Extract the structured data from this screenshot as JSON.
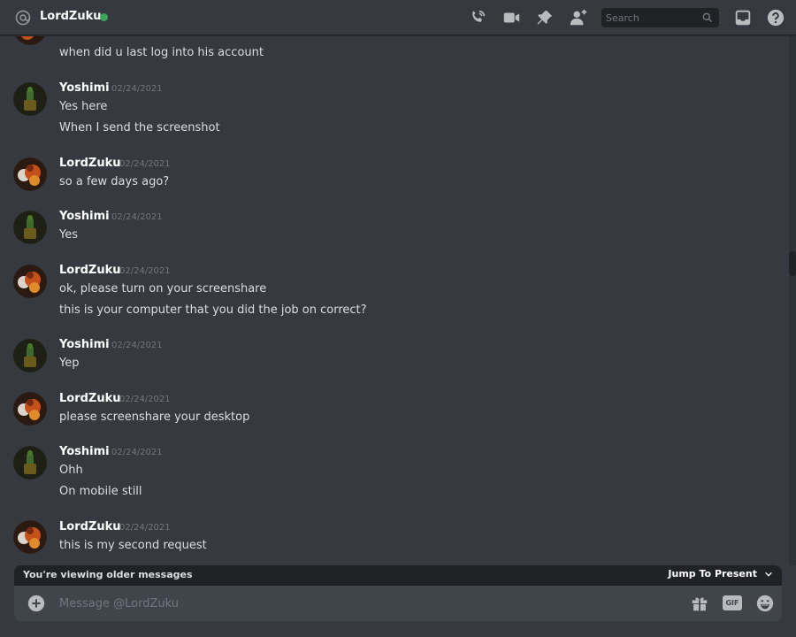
{
  "header": {
    "dm_name": "LordZuku",
    "search_placeholder": "Search",
    "icons": [
      "at-icon",
      "phone-icon",
      "video-icon",
      "pin-icon",
      "add-friend-icon",
      "search-icon",
      "inbox-icon",
      "help-icon"
    ],
    "status_color": "#3ba55d"
  },
  "messages": [
    {
      "lines": [
        "when did u last log into his account"
      ]
    },
    {
      "author": "Yoshimi",
      "timestamp": "02/24/2021",
      "lines": [
        "Yes here",
        "When I send the screenshot"
      ]
    },
    {
      "author": "LordZuku",
      "timestamp": "02/24/2021",
      "lines": [
        "so a few days ago?"
      ]
    },
    {
      "author": "Yoshimi",
      "timestamp": "02/24/2021",
      "lines": [
        "Yes"
      ]
    },
    {
      "author": "LordZuku",
      "timestamp": "02/24/2021",
      "lines": [
        "ok, please turn on your screenshare",
        "this is your computer that you did the job on correct?"
      ]
    },
    {
      "author": "Yoshimi",
      "timestamp": "02/24/2021",
      "lines": [
        "Yep"
      ]
    },
    {
      "author": "LordZuku",
      "timestamp": "02/24/2021",
      "lines": [
        "please screenshare your desktop"
      ]
    },
    {
      "author": "Yoshimi",
      "timestamp": "02/24/2021",
      "lines": [
        "Ohh",
        "On mobile still"
      ]
    },
    {
      "author": "LordZuku",
      "timestamp": "02/24/2021",
      "lines": [
        "this is my second request"
      ]
    }
  ],
  "older_bar": {
    "text": "You're viewing older messages",
    "jump_label": "Jump To Present"
  },
  "composer": {
    "placeholder": "Message @LordZuku",
    "gif_label": "GIF",
    "icons": [
      "plus-circle-icon",
      "gift-icon",
      "gif-icon",
      "emoji-icon"
    ]
  },
  "colors": {
    "background": "#36393f",
    "text": "#dcddde",
    "muted": "#72767d",
    "input_bg": "#40444b",
    "bar_bg": "#202225"
  }
}
